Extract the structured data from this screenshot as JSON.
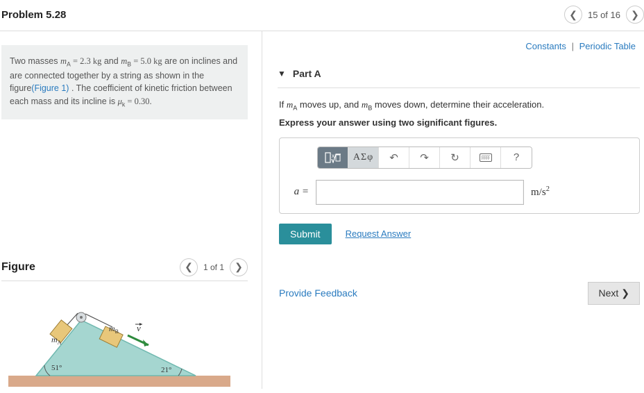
{
  "header": {
    "title": "Problem 5.28",
    "pager": "15 of 16"
  },
  "problem": {
    "text_1": "Two masses ",
    "mA": "m",
    "mA_sub": "A",
    "mA_val": " = 2.3 kg",
    "text_2": " and ",
    "mB": "m",
    "mB_sub": "B",
    "mB_val": " = 5.0 kg",
    "text_3": " are on inclines and are connected together by a string as shown in the figure",
    "fig_link": "(Figure 1)",
    "text_4": " . The coefficient of kinetic friction between each mass and its incline is ",
    "mu": "μ",
    "mu_sub": "k",
    "mu_val": " = 0.30."
  },
  "figure": {
    "heading": "Figure",
    "pager": "1 of 1",
    "labels": {
      "mA": "m",
      "mA_sub": "A",
      "mB": "m",
      "mB_sub": "B",
      "v": "v",
      "angle_left": "51°",
      "angle_right": "21°"
    }
  },
  "right": {
    "constants": "Constants",
    "periodic": "Periodic Table",
    "part_label": "Part A",
    "question_1": "If ",
    "q_mA": "m",
    "q_mA_sub": "A",
    "question_2": " moves up, and ",
    "q_mB": "m",
    "q_mB_sub": "B",
    "question_3": " moves down, determine their acceleration.",
    "instruction": "Express your answer using two significant figures.",
    "toolbar": {
      "greek": "ΑΣφ",
      "help": "?"
    },
    "answer": {
      "label": "a =",
      "unit_base": "m/s",
      "unit_exp": "2"
    },
    "submit": "Submit",
    "request": "Request Answer",
    "feedback": "Provide Feedback",
    "next": "Next"
  }
}
